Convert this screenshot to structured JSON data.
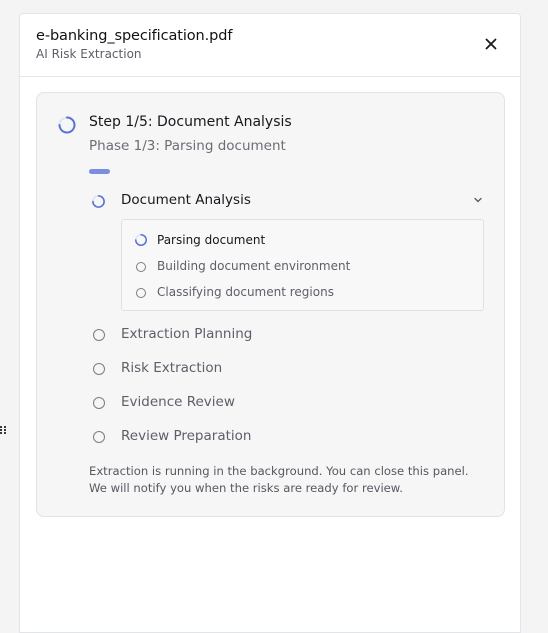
{
  "header": {
    "file_name": "e-banking_specification.pdf",
    "subtitle": "AI Risk Extraction"
  },
  "progress": {
    "step_title": "Step 1/5: Document Analysis",
    "phase_text": "Phase 1/3: Parsing document",
    "fill_fraction": 0.06
  },
  "stages": [
    {
      "label": "Document Analysis",
      "status": "active",
      "expanded": true,
      "substeps": [
        {
          "label": "Parsing document",
          "status": "active"
        },
        {
          "label": "Building document environment",
          "status": "pending"
        },
        {
          "label": "Classifying document regions",
          "status": "pending"
        }
      ]
    },
    {
      "label": "Extraction Planning",
      "status": "pending"
    },
    {
      "label": "Risk Extraction",
      "status": "pending"
    },
    {
      "label": "Evidence Review",
      "status": "pending"
    },
    {
      "label": "Review Preparation",
      "status": "pending"
    }
  ],
  "footer_note": "Extraction is running in the background. You can close this panel. We will notify you when the risks are ready for review.",
  "colors": {
    "accent": "#7b8ee0",
    "spinner": "#5b73d6",
    "text_primary": "#17181c",
    "text_muted": "#5d6068"
  },
  "icons": {
    "close": "close-icon",
    "spinner": "spinner-icon",
    "pending": "circle-icon",
    "expand": "chevron-down-icon",
    "drag": "drag-handle-icon"
  }
}
